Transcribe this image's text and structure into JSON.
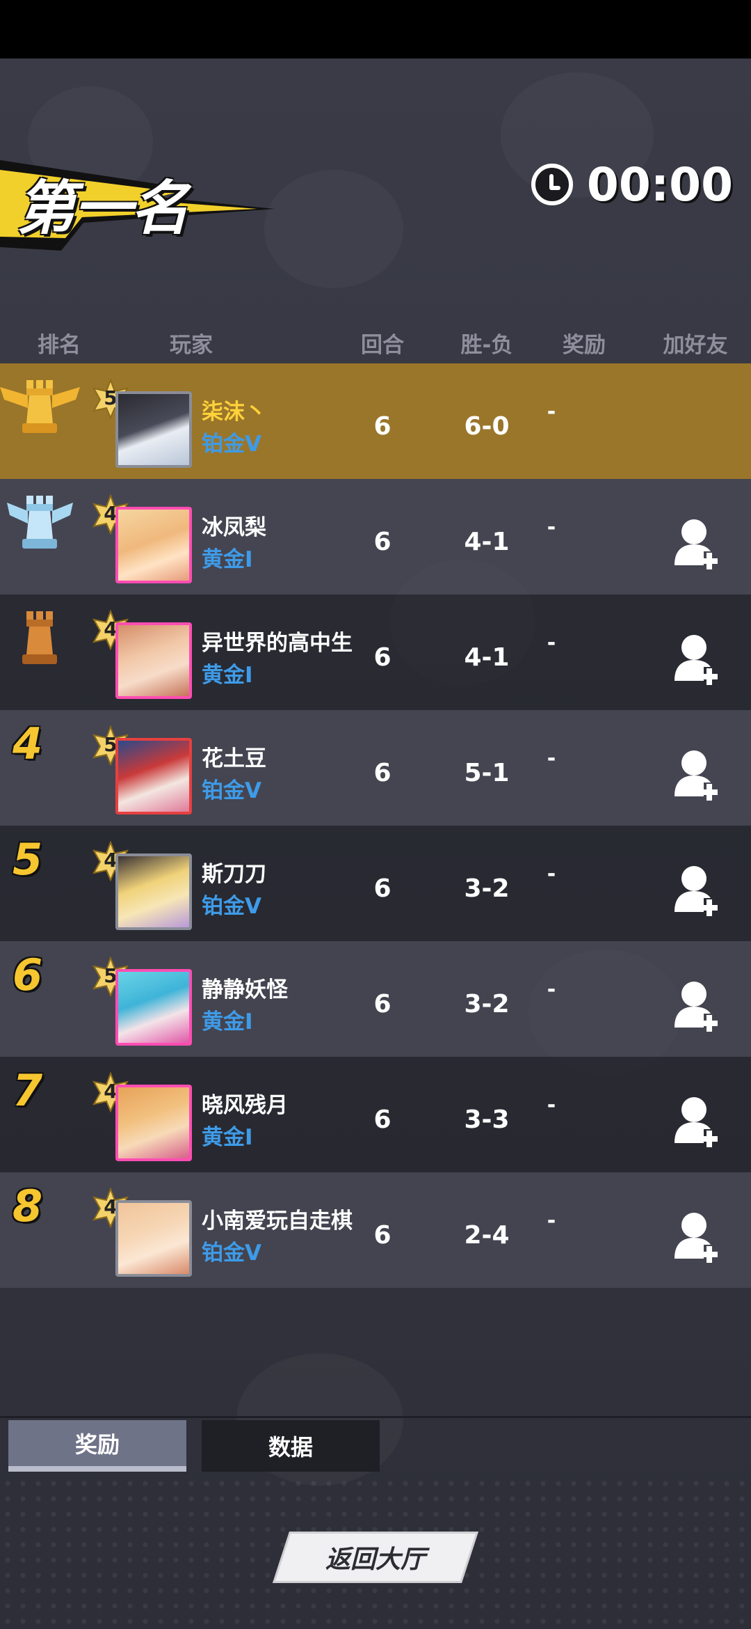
{
  "title": "第一名",
  "timer": {
    "icon": "clock-icon",
    "value": "00:00"
  },
  "columns": {
    "rank": "排名",
    "player": "玩家",
    "rounds": "回合",
    "record": "胜-负",
    "reward": "奖励",
    "add_friend": "加好友"
  },
  "players": [
    {
      "rank": "1",
      "rank_icon": "gold-rook-trophy-icon",
      "level": "5",
      "name": "柒沫丶",
      "tier": "铂金V",
      "rounds": "6",
      "record": "6-0",
      "reward": "-",
      "add_friend": false
    },
    {
      "rank": "2",
      "rank_icon": "silver-rook-trophy-icon",
      "level": "4",
      "name": "冰凤梨",
      "tier": "黄金I",
      "rounds": "6",
      "record": "4-1",
      "reward": "-",
      "add_friend": true
    },
    {
      "rank": "3",
      "rank_icon": "bronze-rook-trophy-icon",
      "level": "4",
      "name": "异世界的高中生",
      "tier": "黄金I",
      "rounds": "6",
      "record": "4-1",
      "reward": "-",
      "add_friend": true
    },
    {
      "rank": "4",
      "level": "5",
      "name": "花土豆",
      "tier": "铂金V",
      "rounds": "6",
      "record": "5-1",
      "reward": "-",
      "add_friend": true
    },
    {
      "rank": "5",
      "level": "4",
      "name": "斯刀刀",
      "tier": "铂金V",
      "rounds": "6",
      "record": "3-2",
      "reward": "-",
      "add_friend": true
    },
    {
      "rank": "6",
      "level": "5",
      "name": "静静妖怪",
      "tier": "黄金I",
      "rounds": "6",
      "record": "3-2",
      "reward": "-",
      "add_friend": true
    },
    {
      "rank": "7",
      "level": "4",
      "name": "晓风残月",
      "tier": "黄金I",
      "rounds": "6",
      "record": "3-3",
      "reward": "-",
      "add_friend": true
    },
    {
      "rank": "8",
      "level": "4",
      "name": "小南爱玩自走棋",
      "tier": "铂金V",
      "rounds": "6",
      "record": "2-4",
      "reward": "-",
      "add_friend": true
    }
  ],
  "tabs": {
    "reward": "奖励",
    "data": "数据"
  },
  "return_button": "返回大厅",
  "colors": {
    "first_row": "#b08425",
    "rank_number": "#f6c630",
    "tier_text": "#3e9be8",
    "first_name": "#ffd23a"
  }
}
